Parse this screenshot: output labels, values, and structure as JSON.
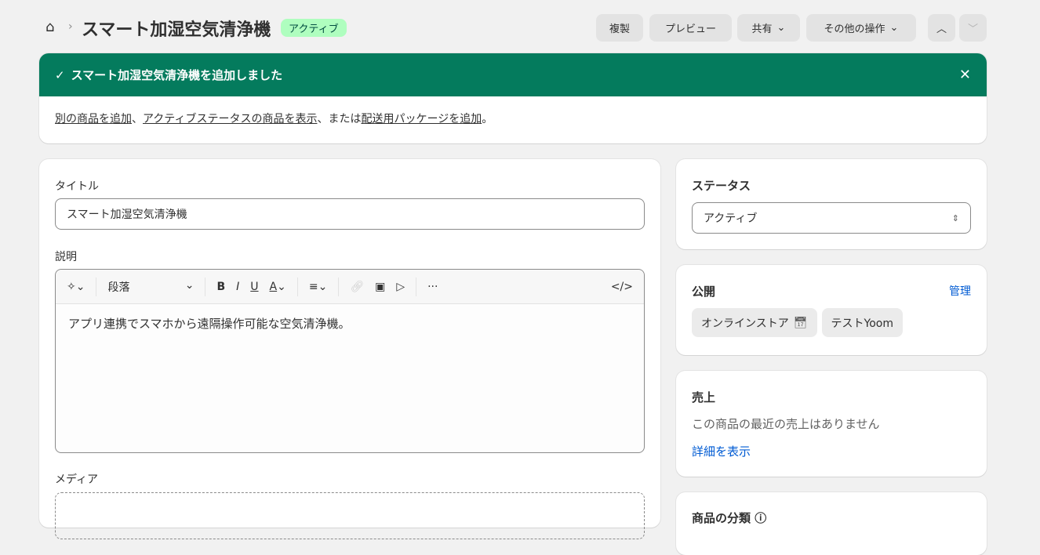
{
  "header": {
    "title": "スマート加湿空気清浄機",
    "status_badge": "アクティブ",
    "buttons": {
      "duplicate": "複製",
      "preview": "プレビュー",
      "share": "共有",
      "more_actions": "その他の操作"
    }
  },
  "banner": {
    "title": "スマート加湿空気清浄機を追加しました",
    "link1": "別の商品を追加",
    "sep1": "、",
    "link2": "アクティブステータスの商品を表示",
    "sep2": "、または",
    "link3": "配送用パッケージを追加",
    "end": "。"
  },
  "main": {
    "title_label": "タイトル",
    "title_value": "スマート加湿空気清浄機",
    "description_label": "説明",
    "paragraph_select": "段落",
    "description_text": "アプリ連携でスマホから遠隔操作可能な空気清浄機。",
    "media_label": "メディア"
  },
  "sidebar": {
    "status": {
      "heading": "ステータス",
      "value": "アクティブ"
    },
    "publishing": {
      "heading": "公開",
      "manage": "管理",
      "channels": [
        "オンラインストア",
        "テストYoom"
      ]
    },
    "sales": {
      "heading": "売上",
      "text": "この商品の最近の売上はありません",
      "link": "詳細を表示"
    },
    "category": {
      "heading": "商品の分類"
    }
  }
}
